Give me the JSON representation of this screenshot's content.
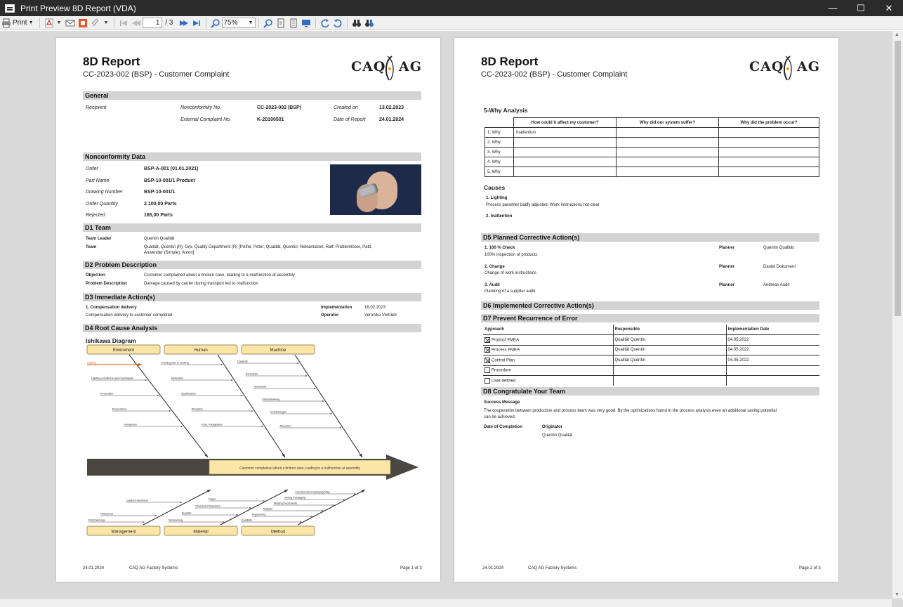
{
  "window": {
    "title": "Print Preview 8D Report (VDA)"
  },
  "toolbar": {
    "print_label": "Print",
    "page_current": "1",
    "page_total": "/ 3",
    "zoom": "75%"
  },
  "report": {
    "title": "8D Report",
    "subtitle": "CC-2023-002 (BSP) - Customer Complaint",
    "logo_left": "CAQ",
    "logo_right": "AG"
  },
  "page1": {
    "general": {
      "heading": "General",
      "recipient_label": "Recipient",
      "nc_no_label": "Nonconformity No.",
      "nc_no": "CC-2023-002 (BSP)",
      "created_label": "Created on",
      "created": "13.02.2023",
      "ext_label": "External Complaint No.",
      "ext": "K-20100501",
      "date_label": "Date of Report",
      "date": "24.01.2024"
    },
    "ncdata": {
      "heading": "Nonconformity Data",
      "rows": [
        {
          "label": "Order",
          "value": "BSP-A-001 (01.01.2021)"
        },
        {
          "label": "Part Name",
          "value": "BSP-10-001/1 Product"
        },
        {
          "label": "Drawing Number",
          "value": "BSP-10-001/1"
        },
        {
          "label": "Order Quantity",
          "value": "2.100,00 Parts"
        },
        {
          "label": "Rejected",
          "value": "165,00 Parts"
        }
      ]
    },
    "d1": {
      "heading": "D1 Team",
      "leader_label": "Team Leader",
      "leader": "Quentin Qualität",
      "team_label": "Team",
      "team_line1": "Qualität, Quentin (R); Grp. Quality Department (R) [Prüfer, Peter; Qualität, Quentin; Reklamation, Ralf; Problemlöser, Patti;",
      "team_line2": "Anwender (Simple), Anton]"
    },
    "d2": {
      "heading": "D2 Problem Description",
      "objection_label": "Objection",
      "objection": "Customer complained about a broken case, leading to a malfunction at assembly",
      "problem_label": "Problem Description",
      "problem": "Damage caused by carrier during transport led to malfunction"
    },
    "d3": {
      "heading": "D3 Immediate Action(s)",
      "action_title": "1. Compensation delivery",
      "action_desc": "Compensation delivery to customer completed",
      "impl_label": "Implementation",
      "impl": "16.02.2023",
      "operator_label": "Operator",
      "operator": "Veronika Vertrieb"
    },
    "d4": {
      "heading": "D4 Root Cause Analysis",
      "ishikawa_title": "Ishikawa Diagram",
      "top_categories": [
        "Enviroment",
        "Human",
        "Machine"
      ],
      "bottom_categories": [
        "Management",
        "Material",
        "Method"
      ],
      "effect": "Customer complained about a broken case, leading to a malfunction at assembly",
      "highlight_cause": "Lighting",
      "env_causes": [
        "Lighting conditions work inadequate",
        "Temperatur",
        "Temperature",
        "Vibrationen"
      ],
      "human_causes": [
        "Training plan is missing",
        "Motivation",
        "Qualification",
        "Discipline",
        "Körp. Fähigkeiten"
      ],
      "machine_causes": [
        "Capacity",
        "Parameter",
        "Verschleiß",
        "Instandhaltung",
        "Einstellungen",
        "Abnutzen"
      ],
      "mgmt_causes": [
        "Capital Investment",
        "Resources",
        "Entscheidung"
      ],
      "material_causes": [
        "Paper",
        "Chemical Characters",
        "Supplier",
        "Versandung"
      ],
      "method_causes": [
        "Incorrect Accompanying Map",
        "Wrong Packaging",
        "Missing Documents",
        "Testplan",
        "Ergonomics",
        "Qualitäts"
      ]
    },
    "footer": {
      "date": "24.01.2024",
      "company": "CAQ AG Factory Systems",
      "page": "Page 1 of 3"
    }
  },
  "page2": {
    "why": {
      "title": "5-Why Analysis",
      "headers": [
        "How could it affect my customer?",
        "Why did our system suffer?",
        "Why did the problem occur?"
      ],
      "rows": [
        {
          "label": "1. Why",
          "c1": "Inattention",
          "c2": "",
          "c3": ""
        },
        {
          "label": "2. Why",
          "c1": "",
          "c2": "",
          "c3": ""
        },
        {
          "label": "3. Why",
          "c1": "",
          "c2": "",
          "c3": ""
        },
        {
          "label": "4. Why",
          "c1": "",
          "c2": "",
          "c3": ""
        },
        {
          "label": "5. Why",
          "c1": "",
          "c2": "",
          "c3": ""
        }
      ]
    },
    "causes": {
      "title": "Causes",
      "c1_title": "1. Lighting",
      "c1_desc": "Process paramter badly adjusted. Work instructions not clear",
      "c2_title": "2. Inattention"
    },
    "d5": {
      "heading": "D5 Planned Corrective Action(s)",
      "planner_label": "Planner",
      "items": [
        {
          "title": "1. 100 % Check",
          "desc": "100% inspection of products",
          "planner": "Quentin Qualität"
        },
        {
          "title": "2. Change",
          "desc": "Change of work instructions",
          "planner": "Daniel Dokument"
        },
        {
          "title": "3. Audit",
          "desc": "Planning of a supplier audit",
          "planner": "Andreas Audit"
        }
      ]
    },
    "d6": {
      "heading": "D6 Implemented Corrective Action(s)"
    },
    "d7": {
      "heading": "D7 Prevent Recurrence of Error",
      "headers": [
        "Approach",
        "Responsible",
        "Implementation Date"
      ],
      "rows": [
        {
          "approach": "Product FMEA",
          "checked": true,
          "responsible": "Qualität Quentin",
          "date": "04.05.2022"
        },
        {
          "approach": "Process FMEA",
          "checked": true,
          "responsible": "Qualität Quentin",
          "date": "04.05.2022"
        },
        {
          "approach": "Control Plan",
          "checked": true,
          "responsible": "Qualität Quentin",
          "date": "04.05.2022"
        },
        {
          "approach": "Procedure",
          "checked": false,
          "responsible": "",
          "date": ""
        },
        {
          "approach": "User-defined",
          "checked": false,
          "responsible": "",
          "date": ""
        }
      ]
    },
    "d8": {
      "heading": "D8 Congratulate Your Team",
      "success_label": "Success Message",
      "success_line1": "The cooperation between production and process team was very good. By the optimizations found in the process analysis even an additional saving potential",
      "success_line2": "can be achieved.",
      "completion_label": "Date of Completion",
      "originator_label": "Originator",
      "originator": "Quentin Qualität"
    },
    "footer": {
      "date": "24.01.2024",
      "company": "CAQ AG Factory Systems",
      "page": "Page 2 of 3"
    }
  },
  "colors": {
    "titlebar": "#2b2b2b",
    "section": "#d3d3d3",
    "category_fill": "#fbe5a7",
    "arrow": "#4a4640",
    "highlight": "#e0561b"
  }
}
